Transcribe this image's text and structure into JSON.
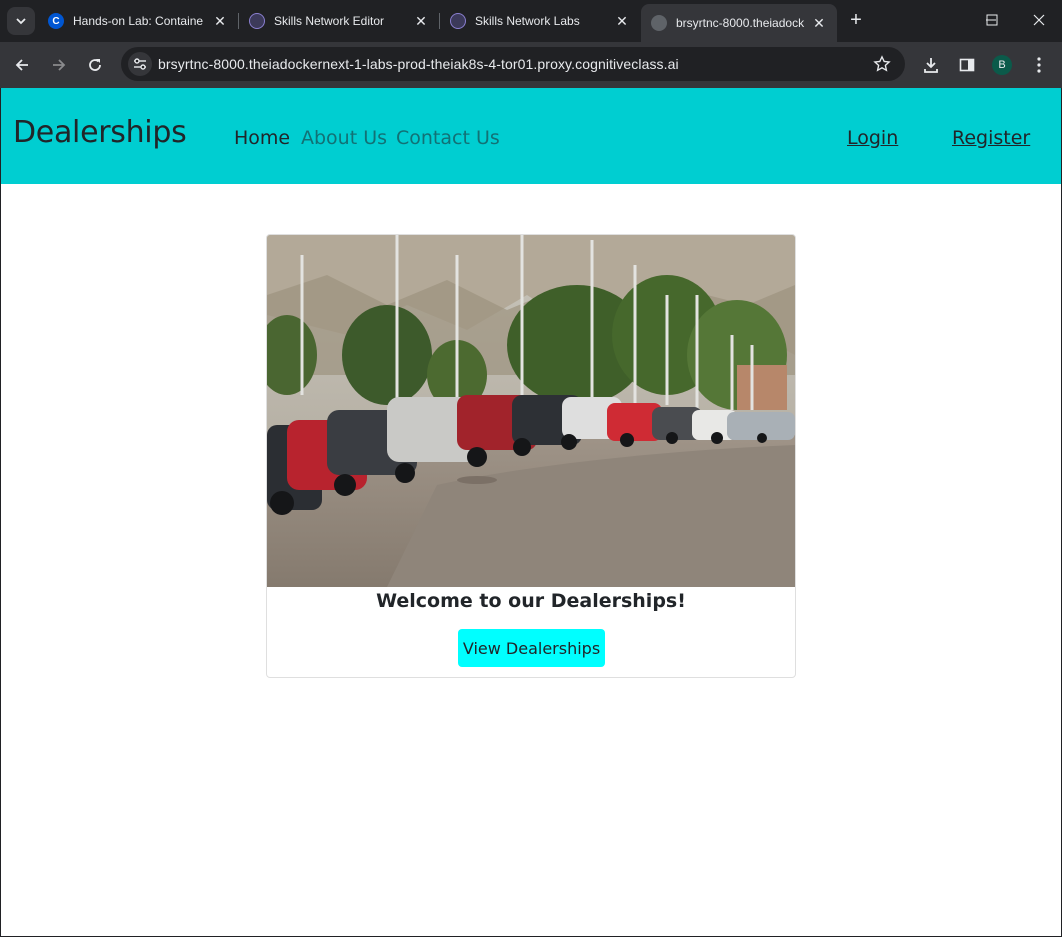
{
  "browser": {
    "tabs": [
      {
        "title": "Hands-on Lab: Containe",
        "favicon": "coursera-icon",
        "active": false
      },
      {
        "title": "Skills Network Editor",
        "favicon": "skills-network-icon",
        "active": false
      },
      {
        "title": "Skills Network Labs",
        "favicon": "skills-network-icon",
        "active": false
      },
      {
        "title": "brsyrtnc-8000.theiadock",
        "favicon": "globe-icon",
        "active": true
      }
    ],
    "url": "brsyrtnc-8000.theiadockernext-1-labs-prod-theiak8s-4-tor01.proxy.cognitiveclass.ai",
    "profile_initial": "B"
  },
  "navbar": {
    "brand": "Dealerships",
    "links": [
      "Home",
      "About Us",
      "Contact Us"
    ],
    "login": "Login",
    "register": "Register",
    "bg_color": "#00ced1"
  },
  "card": {
    "image": "car-dealership-lot-photo",
    "title": "Welcome to our Dealerships!",
    "button": "View Dealerships",
    "button_color": "#00ffff"
  }
}
